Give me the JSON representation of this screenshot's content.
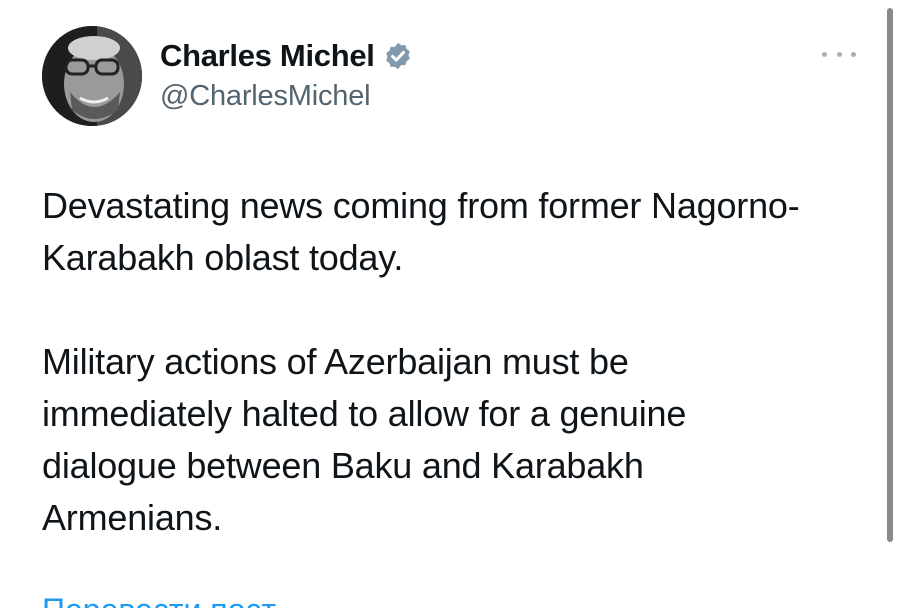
{
  "author": {
    "display_name": "Charles Michel",
    "handle": "@CharlesMichel",
    "verified_icon": "verified-badge-icon",
    "avatar_icon": "profile-photo"
  },
  "menu": {
    "icon": "more-options-icon"
  },
  "tweet": {
    "paragraphs": [
      "Devastating news coming from former Nagorno-\nKarabakh oblast today.",
      "Military actions of Azerbaijan must be\nimmediately halted to allow for a genuine\ndialogue between Baku and Karabakh\nArmenians."
    ],
    "translate_label": "Перевести пост"
  },
  "colors": {
    "text": "#0f1419",
    "secondary": "#536471",
    "link": "#1d9bf0",
    "badge": "#829aab"
  }
}
